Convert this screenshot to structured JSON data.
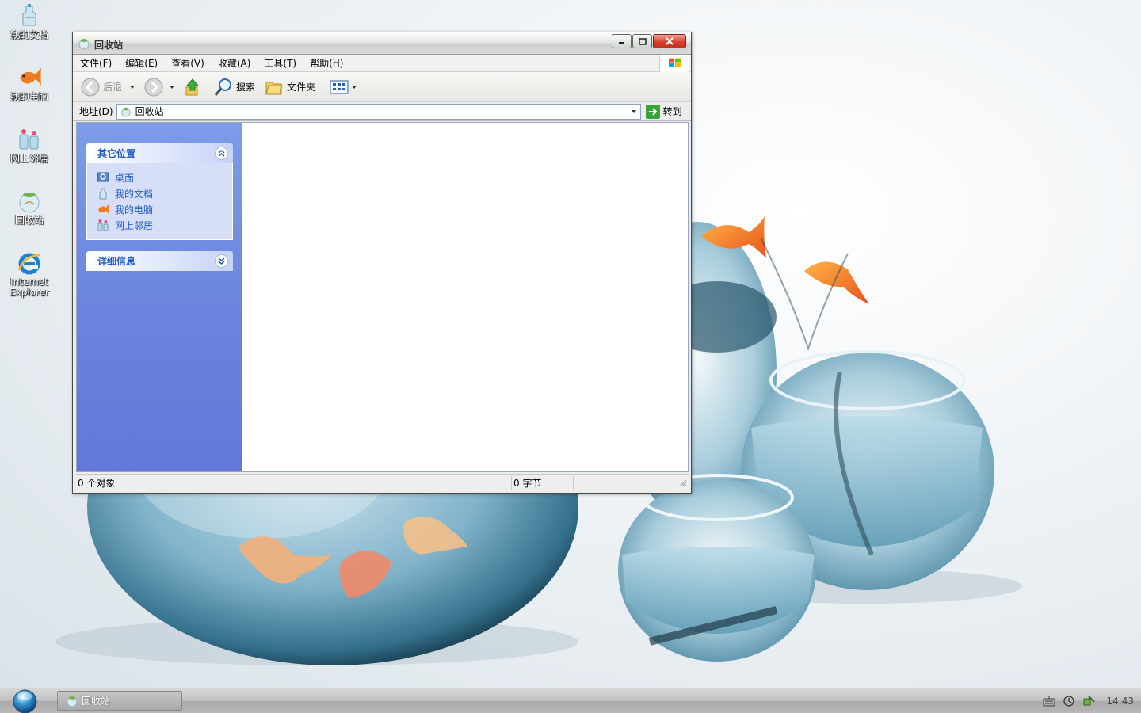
{
  "desktop": {
    "icons": [
      {
        "label": "我的文档",
        "icon": "my-documents-icon"
      },
      {
        "label": "我的电脑",
        "icon": "my-computer-icon"
      },
      {
        "label": "网上邻居",
        "icon": "network-places-icon"
      },
      {
        "label": "回收站",
        "icon": "recycle-bin-icon"
      },
      {
        "label": "Internet Explorer",
        "icon": "internet-explorer-icon"
      }
    ]
  },
  "window": {
    "title": "回收站",
    "menu": [
      "文件(F)",
      "编辑(E)",
      "查看(V)",
      "收藏(A)",
      "工具(T)",
      "帮助(H)"
    ],
    "toolbar": {
      "back_label": "后退",
      "search_label": "搜索",
      "folders_label": "文件夹"
    },
    "address": {
      "label": "地址(D)",
      "value": "回收站",
      "go_label": "转到"
    },
    "taskpane": {
      "other_places": {
        "title": "其它位置",
        "links": [
          "桌面",
          "我的文档",
          "我的电脑",
          "网上邻居"
        ]
      },
      "details": {
        "title": "详细信息"
      }
    },
    "status": {
      "objects": "0 个对象",
      "size": "0 字节"
    }
  },
  "taskbar": {
    "task_label": "回收站",
    "clock": "14:43"
  },
  "colors": {
    "taskpane_link": "#215dc6",
    "taskpane_bg": "#6c86de",
    "close_button": "#d8412c"
  }
}
